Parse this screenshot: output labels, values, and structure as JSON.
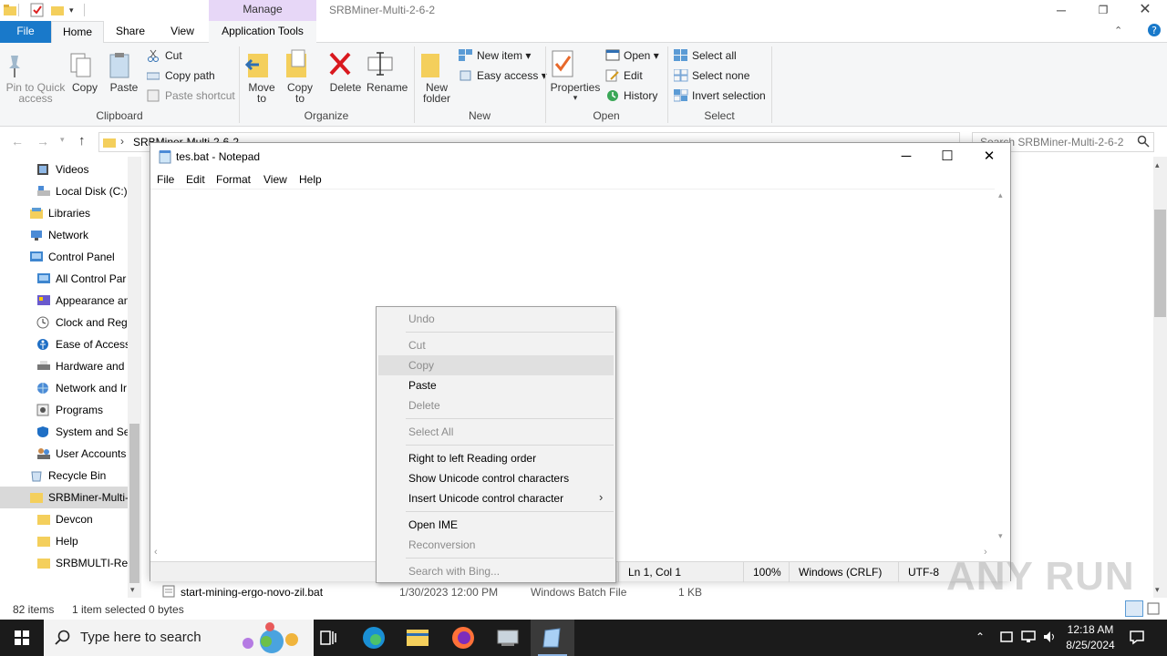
{
  "explorer": {
    "window_title": "SRBMiner-Multi-2-6-2",
    "contextual_tab_header": "Manage",
    "tabs": {
      "file": "File",
      "home": "Home",
      "share": "Share",
      "view": "View",
      "app_tools": "Application Tools"
    },
    "ribbon": {
      "clipboard": {
        "label": "Clipboard",
        "pin": "Pin to Quick access",
        "copy": "Copy",
        "paste": "Paste",
        "cut": "Cut",
        "copy_path": "Copy path",
        "paste_shortcut": "Paste shortcut"
      },
      "organize": {
        "label": "Organize",
        "move_to": "Move to",
        "copy_to": "Copy to",
        "delete": "Delete",
        "rename": "Rename"
      },
      "new": {
        "label": "New",
        "new_folder": "New folder",
        "new_item": "New item",
        "easy_access": "Easy access"
      },
      "open": {
        "label": "Open",
        "properties": "Properties",
        "open": "Open",
        "edit": "Edit",
        "history": "History"
      },
      "select": {
        "label": "Select",
        "select_all": "Select all",
        "select_none": "Select none",
        "invert": "Invert selection"
      }
    },
    "address": "SRBMiner-Multi-2-6-2",
    "search_placeholder": "Search SRBMiner-Multi-2-6-2",
    "nav_items": [
      "Videos",
      "Local Disk (C:)",
      "Libraries",
      "Network",
      "Control Panel",
      "All Control Par",
      "Appearance an",
      "Clock and Regi",
      "Ease of Access",
      "Hardware and",
      "Network and Ir",
      "Programs",
      "System and Se",
      "User Accounts",
      "Recycle Bin",
      "SRBMiner-Multi-",
      "Devcon",
      "Help",
      "SRBMULTI-Rest"
    ],
    "file_row": {
      "name": "start-mining-ergo-novo-zil.bat",
      "date": "1/30/2023 12:00 PM",
      "type": "Windows Batch File",
      "size": "1 KB"
    },
    "status": {
      "items": "82 items",
      "selected": "1 item selected",
      "size": "0 bytes"
    }
  },
  "notepad": {
    "title": "tes.bat - Notepad",
    "menu": [
      "File",
      "Edit",
      "Format",
      "View",
      "Help"
    ],
    "status": {
      "position": "Ln 1, Col 1",
      "zoom": "100%",
      "line_ending": "Windows (CRLF)",
      "encoding": "UTF-8"
    }
  },
  "context_menu": {
    "undo": "Undo",
    "cut": "Cut",
    "copy": "Copy",
    "paste": "Paste",
    "delete": "Delete",
    "select_all": "Select All",
    "rtl": "Right to left Reading order",
    "show_unicode": "Show Unicode control characters",
    "insert_unicode": "Insert Unicode control character",
    "open_ime": "Open IME",
    "reconversion": "Reconversion",
    "search_bing": "Search with Bing..."
  },
  "taskbar": {
    "search_placeholder": "Type here to search",
    "time": "12:18 AM",
    "date": "8/25/2024"
  },
  "watermark": "ANY RUN",
  "colors": {
    "file_tab": "#1979ca",
    "manage_tab": "#e7d7f7",
    "taskbar": "#1b1b1b"
  }
}
